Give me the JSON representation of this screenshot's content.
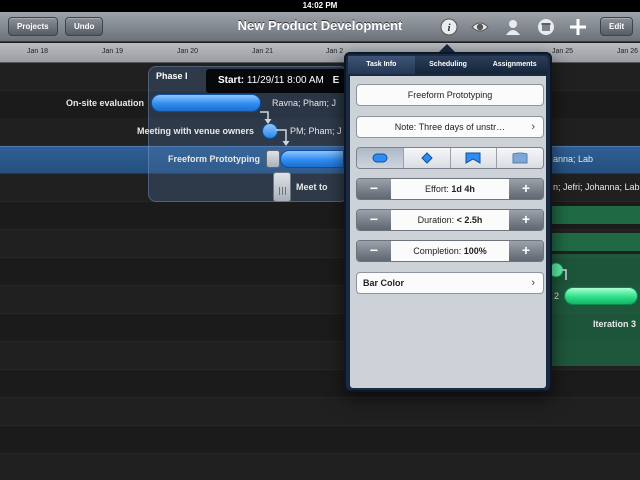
{
  "status_bar": {
    "time": "14:02 PM"
  },
  "toolbar": {
    "title": "New Product Development",
    "projects_label": "Projects",
    "undo_label": "Undo",
    "edit_label": "Edit",
    "icons": [
      "info-icon",
      "eye-icon",
      "person-icon",
      "box-icon",
      "plus-icon"
    ]
  },
  "timeline": {
    "dates": [
      "Jan 18",
      "Jan 19",
      "Jan 20",
      "Jan 21",
      "Jan 2",
      "Jan 25",
      "Jan 26"
    ]
  },
  "gantt": {
    "phase_label": "Phase I",
    "start_tip": {
      "label": "Start:",
      "value": "11/29/11 8:00 AM",
      "trailing": "E"
    },
    "rows": [
      {
        "task": "On-site evaluation",
        "resources": "Ravna; Pham; J"
      },
      {
        "task": "Meeting with venue owners",
        "resources": "PM; Pham; J"
      },
      {
        "task": "Freeform Prototyping",
        "resources": "anna; Lab"
      },
      {
        "task": "Meet to",
        "resources": "n; Jefri; Johanna; Lab"
      }
    ],
    "right_labels": {
      "iteration": "Iteration 3",
      "fragment": "2"
    }
  },
  "popover": {
    "tabs": [
      "Task Info",
      "Scheduling",
      "Assignments"
    ],
    "active_tab": 0,
    "task_name": "Freeform Prototyping",
    "note": "Note: Three days of unstr…",
    "shapes": [
      "bar-shape-icon",
      "diamond-shape-icon",
      "bracket-shape-icon",
      "group-shape-icon"
    ],
    "effort": {
      "label": "Effort:",
      "value": "1d 4h"
    },
    "duration": {
      "label": "Duration:",
      "value": "< 2.5h"
    },
    "completion": {
      "label": "Completion:",
      "value": "100%"
    },
    "bar_color_label": "Bar Color",
    "minus": "−",
    "plus": "+"
  },
  "colors": {
    "selected_row": "#2a5688",
    "task_bar": "#2f8cf0",
    "group_bar": "#2fe08a",
    "popover_frame": "#1a2a40"
  }
}
